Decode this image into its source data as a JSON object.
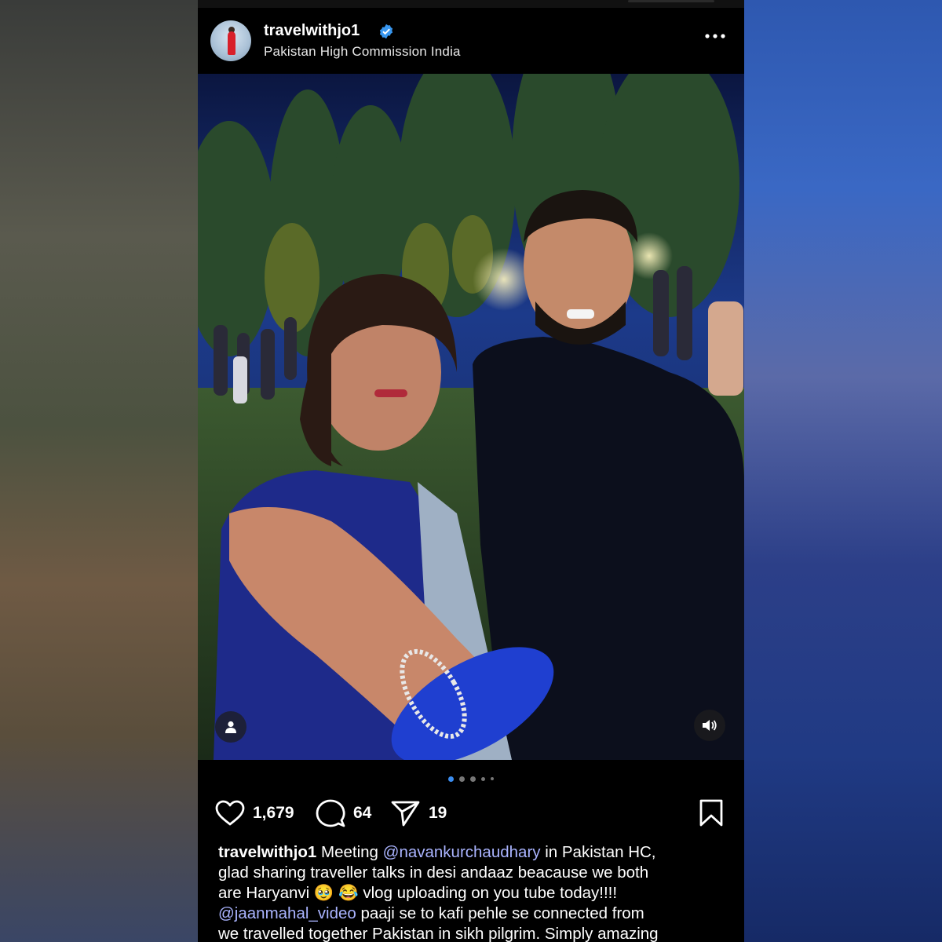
{
  "post": {
    "username": "travelwithjo1",
    "location": "Pakistan High Commission India",
    "verified": true
  },
  "actions": {
    "likes": "1,679",
    "comments": "64",
    "shares": "19"
  },
  "carousel": {
    "total_dots": 5,
    "active_index": 0
  },
  "caption": {
    "username": "travelwithjo1",
    "line1_text": " Meeting ",
    "mention1": "@navankurchaudhary",
    "line1_after": " in Pakistan HC,",
    "line2": "glad sharing traveller talks in desi andaaz beacause we both",
    "line3_text": "are Haryanvi ",
    "emojis": "🥹 😂",
    "line3_after": " vlog uploading on you tube today!!!!",
    "mention2": "@jaanmahal_video",
    "line4_after": " paaji se to kafi pehle se connected from",
    "line5": "we travelled together Pakistan in sikh pilgrim. Simply amazing"
  },
  "colors": {
    "background_left": "#5a5a4e",
    "background_right": "#2e58b0",
    "mention": "#aab4ff",
    "active_dot": "#3b8df0",
    "verified": "#3897f0"
  },
  "icons": [
    "verified-badge-icon",
    "more-options-icon",
    "user-tag-icon",
    "sound-icon",
    "heart-icon",
    "comment-icon",
    "share-icon",
    "bookmark-icon"
  ]
}
